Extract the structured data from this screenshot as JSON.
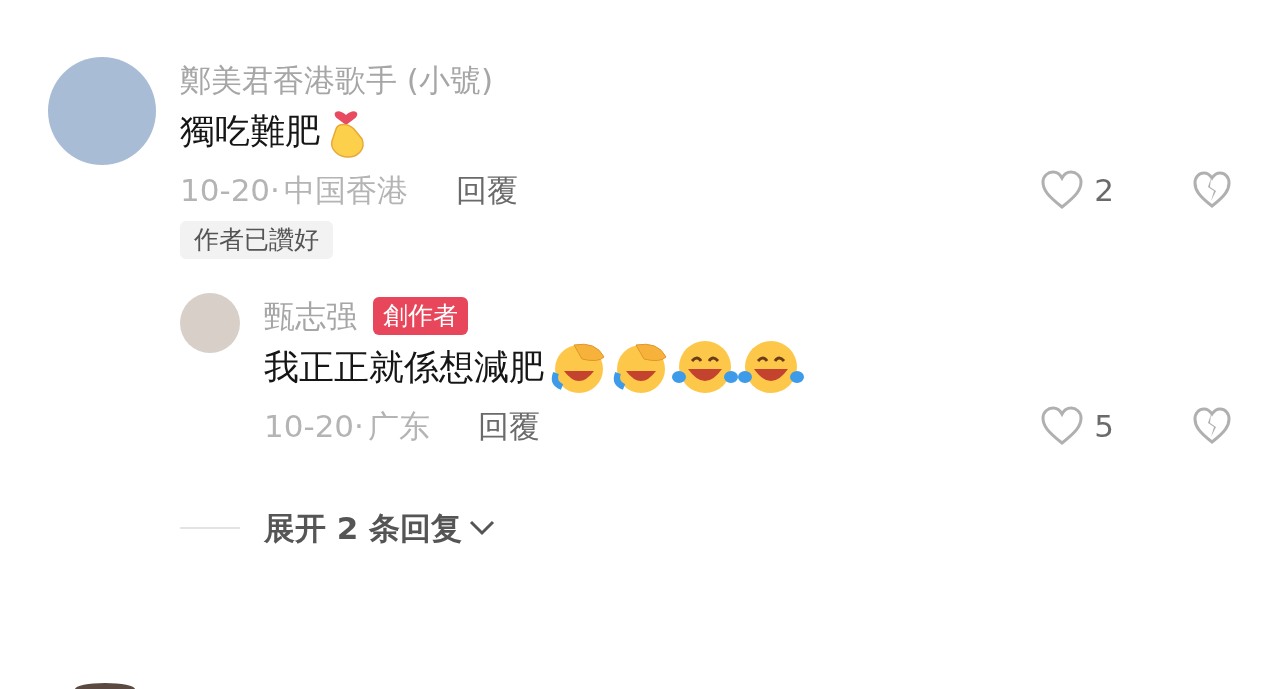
{
  "comments": [
    {
      "author": "鄭美君香港歌手 (小號)",
      "text": "獨吃難肥",
      "emojis": [
        {
          "kind": "finger-heart"
        }
      ],
      "date": "10-20·",
      "location": "中国香港",
      "reply_label": "回覆",
      "likes": "2",
      "liked": false,
      "tag": "作者已讚好",
      "replies": [
        {
          "author": "甄志强",
          "badge": "創作者",
          "text": "我正正就係想減肥",
          "emojis": [
            {
              "kind": "facepalm-laugh"
            },
            {
              "kind": "facepalm-laugh"
            },
            {
              "kind": "tears-of-joy"
            },
            {
              "kind": "tears-of-joy"
            }
          ],
          "date": "10-20·",
          "location": "广东",
          "reply_label": "回覆",
          "likes": "5",
          "liked": false
        }
      ],
      "expand": "展开 2 条回复"
    }
  ]
}
